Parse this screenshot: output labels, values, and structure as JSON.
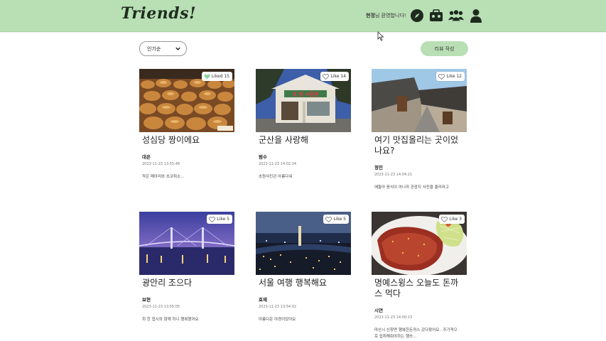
{
  "header": {
    "logo": "Triends!",
    "welcome_name": "현정",
    "welcome_suffix": "님 환영합니다!"
  },
  "controls": {
    "sort_value": "인기순",
    "review_button": "리뷰 작성"
  },
  "posts": [
    {
      "title": "성심당 짱이에요",
      "author": "대은",
      "date": "2023-11-23 13:55:48",
      "body": "작은 메아리와 초코튀소...",
      "like_label": "Liked 15",
      "liked": true
    },
    {
      "title": "군산을 사랑해",
      "author": "범수",
      "date": "2023-11-23 14:02:24",
      "body": "초원사진관 아름다워",
      "like_label": "Like 14",
      "liked": false
    },
    {
      "title": "여기 맛집올리는 곳이었나요?",
      "author": "정민",
      "date": "2023-11-23 14:04:21",
      "body": "애들아 음식이 아니라 관광지 사진을 올리라고",
      "like_label": "Like 12",
      "liked": false
    },
    {
      "title": "광안리 조으다",
      "author": "보현",
      "date": "2023-11-23 13:55:05",
      "body": "회 한 접시와 함께 하니 행복했어요",
      "like_label": "Like 5",
      "liked": false
    },
    {
      "title": "서울 여행 행복해요",
      "author": "효재",
      "date": "2023-11-23 13:54:02",
      "body": "아름다운 야경이었어요",
      "like_label": "Like 5",
      "liked": false
    },
    {
      "title": "명예스윙스 오늘도 돈까스 먹다",
      "author": "시연",
      "date": "2023-11-23 14:00:23",
      "body": "마산시 신창면 행복한돈까스 갔다왔어요.. 주기적으로 섭취해줘야하는 행쓰...",
      "like_label": "Like 3",
      "liked": false
    }
  ],
  "colors": {
    "header_bg": "#b9dfb5",
    "accent": "#b9dfb5",
    "liked_heart": "#8fd6a4"
  },
  "icons": [
    "compass-icon",
    "map-bag-icon",
    "group-icon",
    "user-icon",
    "heart-icon",
    "chevron-down-icon"
  ]
}
